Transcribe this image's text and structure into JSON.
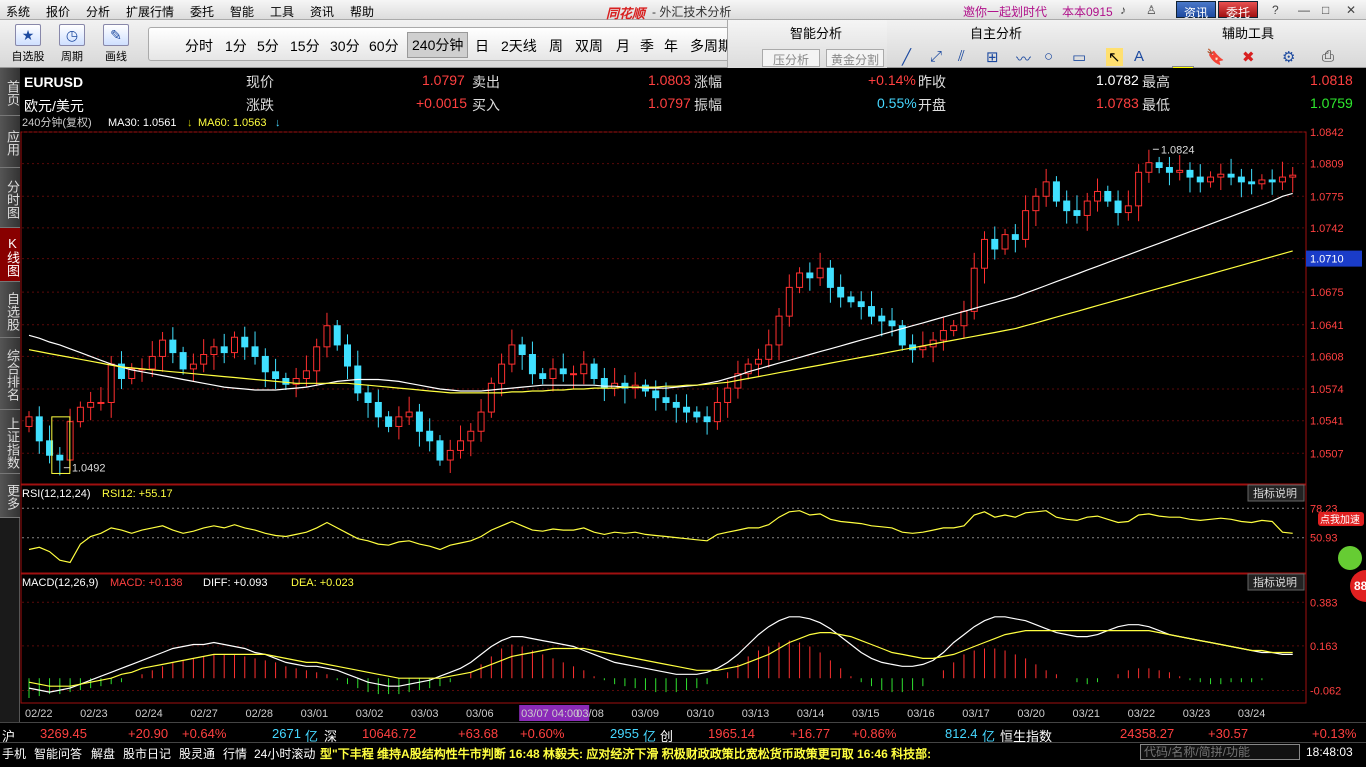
{
  "menu": [
    "系统",
    "报价",
    "分析",
    "扩展行情",
    "委托",
    "智能",
    "工具",
    "资讯",
    "帮助"
  ],
  "brand": "同花顺",
  "app_title": "- 外汇技术分析",
  "promo": "邀你一起划时代",
  "version": "本本0915",
  "top_buttons": [
    "资讯",
    "委托"
  ],
  "toolbar": {
    "tools": [
      {
        "label": "自选股",
        "icon": "star-icon"
      },
      {
        "label": "周期",
        "icon": "clock-icon"
      },
      {
        "label": "画线",
        "icon": "pen-icon"
      }
    ],
    "periods": [
      "分时",
      "1分",
      "5分",
      "15分",
      "30分",
      "60分",
      "240分钟",
      "日",
      "2天线",
      "周",
      "双周",
      "月",
      "季",
      "年",
      "多周期"
    ],
    "active_period": "240分钟",
    "smart_title": "智能分析",
    "smart_buttons": [
      "压分析",
      "黄金分割"
    ],
    "draw_title": "自主分析",
    "aux_title": "辅助工具"
  },
  "side_tabs": [
    "首页",
    "应用",
    "分时图",
    "K线图",
    "自选股",
    "综合排名",
    "上证指数",
    "更多"
  ],
  "active_side_tab": "K线图",
  "quote": {
    "symbol": "EURUSD",
    "name": "欧元/美元",
    "labels": [
      "现价",
      "涨跌",
      "卖出",
      "买入",
      "涨幅",
      "振幅",
      "昨收",
      "开盘",
      "最高",
      "最低"
    ],
    "now": "1.0797",
    "change": "+0.0015",
    "ask": "1.0803",
    "bid": "1.0797",
    "change_pct": "+0.14%",
    "amplitude": "0.55%",
    "prev_close": "1.0782",
    "open": "1.0783",
    "high": "1.0818",
    "low": "1.0759"
  },
  "main_legend": {
    "period": "240分钟(复权)",
    "ma30": "MA30: 1.0561",
    "ma60": "MA60: 1.0563"
  },
  "rsi_legend": {
    "name": "RSI(12,12,24)",
    "value": "RSI12: +55.17"
  },
  "macd_legend": {
    "name": "MACD(12,26,9)",
    "macd": "MACD: +0.138",
    "diff": "DIFF: +0.093",
    "dea": "DEA: +0.023"
  },
  "indicator_help": "指标说明",
  "promo_badge": "点我加速",
  "badge_number": "88",
  "chart_data": {
    "type": "candlestick",
    "y_ticks": [
      "1.0842",
      "1.0809",
      "1.0775",
      "1.0742",
      "1.0710",
      "1.0675",
      "1.0641",
      "1.0608",
      "1.0574",
      "1.0541",
      "1.0507"
    ],
    "current_price_label": "1.0710",
    "ylim": [
      1.0475,
      1.0842
    ],
    "annotations": [
      {
        "text": "1.0824",
        "value": 1.0824
      },
      {
        "text": "1.0492",
        "value": 1.0492
      }
    ],
    "dates": [
      "02/22",
      "02/23",
      "02/24",
      "02/27",
      "02/28",
      "03/01",
      "03/02",
      "03/03",
      "03/06",
      "03/07 04:00",
      "03/08",
      "03/09",
      "03/10",
      "03/13",
      "03/14",
      "03/15",
      "03/16",
      "03/17",
      "03/20",
      "03/21",
      "03/22",
      "03/23",
      "03/24"
    ],
    "highlight_date": "03/07 04:00",
    "close": [
      1.0545,
      1.052,
      1.0505,
      1.05,
      1.054,
      1.0555,
      1.056,
      1.056,
      1.06,
      1.0585,
      1.0595,
      1.0595,
      1.0608,
      1.0625,
      1.0612,
      1.0595,
      1.06,
      1.061,
      1.0618,
      1.0612,
      1.0628,
      1.0618,
      1.0608,
      1.0592,
      1.0585,
      1.0579,
      1.0585,
      1.0593,
      1.0618,
      1.064,
      1.062,
      1.0598,
      1.057,
      1.056,
      1.0545,
      1.0535,
      1.0545,
      1.055,
      1.053,
      1.052,
      1.05,
      1.051,
      1.052,
      1.053,
      1.055,
      1.058,
      1.06,
      1.062,
      1.061,
      1.059,
      1.0585,
      1.0595,
      1.059,
      1.059,
      1.06,
      1.0585,
      1.0575,
      1.058,
      1.0575,
      1.0578,
      1.0572,
      1.0565,
      1.056,
      1.0555,
      1.055,
      1.0545,
      1.054,
      1.056,
      1.0575,
      1.059,
      1.06,
      1.0605,
      1.062,
      1.065,
      1.068,
      1.0695,
      1.069,
      1.07,
      1.068,
      1.067,
      1.0665,
      1.066,
      1.065,
      1.0645,
      1.064,
      1.062,
      1.0615,
      1.0618,
      1.0625,
      1.0635,
      1.064,
      1.0655,
      1.07,
      1.073,
      1.072,
      1.0735,
      1.073,
      1.076,
      1.0775,
      1.079,
      1.077,
      1.076,
      1.0755,
      1.077,
      1.078,
      1.077,
      1.0758,
      1.0765,
      1.08,
      1.081,
      1.0805,
      1.08,
      1.0802,
      1.0795,
      1.079,
      1.0795,
      1.0798,
      1.0795,
      1.079,
      1.0788,
      1.0792,
      1.079,
      1.0795,
      1.0797
    ],
    "ma30": [
      1.063,
      1.0627,
      1.0623,
      1.062,
      1.0616,
      1.0612,
      1.0608,
      1.0604,
      1.06,
      1.0597,
      1.0594,
      1.0592,
      1.059,
      1.0588,
      1.0586,
      1.0584,
      1.0582,
      1.058,
      1.0578,
      1.0576,
      1.0575,
      1.0574,
      1.0573,
      1.0573,
      1.0573,
      1.0574,
      1.0575,
      1.0576,
      1.0578,
      1.058,
      1.0582,
      1.0583,
      1.0584,
      1.0584,
      1.0584,
      1.0583,
      1.0582,
      1.058,
      1.0578,
      1.0576,
      1.0574,
      1.0573,
      1.0572,
      1.0572,
      1.0572,
      1.0573,
      1.0574,
      1.0575,
      1.0576,
      1.0577,
      1.0578,
      1.0578,
      1.0578,
      1.0578,
      1.0578,
      1.0578,
      1.0577,
      1.0577,
      1.0576,
      1.0576,
      1.0575,
      1.0575,
      1.0575,
      1.0576,
      1.0577,
      1.0578,
      1.058,
      1.0582,
      1.0585,
      1.0588,
      1.0592,
      1.0595,
      1.0598,
      1.0601,
      1.0604,
      1.0607,
      1.061,
      1.0613,
      1.0616,
      1.0619,
      1.0622,
      1.0625,
      1.0628,
      1.0631,
      1.0634,
      1.0637,
      1.064,
      1.0643,
      1.0646,
      1.0649,
      1.0652,
      1.0655,
      1.0658,
      1.0661,
      1.0664,
      1.0667,
      1.067,
      1.0674,
      1.0678,
      1.0682,
      1.0686,
      1.069,
      1.0694,
      1.0698,
      1.0702,
      1.0706,
      1.071,
      1.0714,
      1.0718,
      1.0722,
      1.0726,
      1.073,
      1.0734,
      1.0738,
      1.0742,
      1.0746,
      1.075,
      1.0754,
      1.0758,
      1.0762,
      1.0766,
      1.077,
      1.0775,
      1.0778
    ],
    "ma60": [
      1.0615,
      1.0613,
      1.0611,
      1.0609,
      1.0607,
      1.0605,
      1.0603,
      1.0601,
      1.0599,
      1.0597,
      1.0596,
      1.0595,
      1.0594,
      1.0593,
      1.0592,
      1.0591,
      1.059,
      1.0589,
      1.0588,
      1.0587,
      1.0586,
      1.0585,
      1.0584,
      1.0583,
      1.0582,
      1.0581,
      1.058,
      1.058,
      1.058,
      1.058,
      1.058,
      1.058,
      1.0579,
      1.0578,
      1.0577,
      1.0576,
      1.0575,
      1.0574,
      1.0573,
      1.0572,
      1.0571,
      1.057,
      1.057,
      1.057,
      1.057,
      1.057,
      1.057,
      1.0571,
      1.0571,
      1.0572,
      1.0572,
      1.0573,
      1.0573,
      1.0574,
      1.0574,
      1.0575,
      1.0575,
      1.0575,
      1.0576,
      1.0576,
      1.0576,
      1.0576,
      1.0577,
      1.0577,
      1.0578,
      1.0578,
      1.0579,
      1.058,
      1.0581,
      1.0583,
      1.0585,
      1.0587,
      1.0589,
      1.0591,
      1.0593,
      1.0595,
      1.0597,
      1.0599,
      1.0601,
      1.0603,
      1.0605,
      1.0607,
      1.0609,
      1.0611,
      1.0613,
      1.0615,
      1.0617,
      1.0619,
      1.0621,
      1.0623,
      1.0625,
      1.0627,
      1.0629,
      1.0631,
      1.0633,
      1.0635,
      1.0637,
      1.064,
      1.0643,
      1.0646,
      1.0649,
      1.0652,
      1.0655,
      1.0658,
      1.0661,
      1.0664,
      1.0667,
      1.067,
      1.0673,
      1.0676,
      1.0679,
      1.0682,
      1.0685,
      1.0688,
      1.0691,
      1.0694,
      1.0697,
      1.07,
      1.0703,
      1.0706,
      1.0709,
      1.0712,
      1.0715,
      1.0718
    ],
    "rsi": {
      "ylim": [
        20,
        85
      ],
      "ticks": [
        "78.23",
        "50.93"
      ],
      "values": [
        40,
        42,
        38,
        30,
        28,
        45,
        52,
        55,
        60,
        58,
        55,
        58,
        60,
        62,
        58,
        55,
        57,
        60,
        62,
        60,
        63,
        60,
        58,
        55,
        53,
        52,
        54,
        56,
        60,
        65,
        60,
        55,
        50,
        48,
        45,
        44,
        47,
        48,
        45,
        43,
        40,
        44,
        46,
        48,
        52,
        58,
        62,
        66,
        62,
        58,
        57,
        59,
        58,
        58,
        60,
        56,
        54,
        56,
        55,
        56,
        54,
        53,
        52,
        51,
        50,
        49,
        48,
        54,
        56,
        58,
        60,
        60,
        63,
        70,
        75,
        76,
        72,
        73,
        68,
        66,
        65,
        64,
        62,
        61,
        60,
        56,
        55,
        56,
        58,
        60,
        60,
        62,
        72,
        75,
        70,
        72,
        70,
        74,
        75,
        76,
        70,
        68,
        67,
        70,
        71,
        68,
        65,
        66,
        72,
        73,
        71,
        70,
        70,
        68,
        67,
        68,
        69,
        68,
        66,
        65,
        67,
        66,
        56,
        55
      ]
    },
    "macd": {
      "ylim": [
        -0.13,
        0.44
      ],
      "ticks": [
        "0.383",
        "0.163",
        "-0.062"
      ],
      "bars": [
        -0.1,
        -0.09,
        -0.08,
        -0.08,
        -0.07,
        -0.06,
        -0.05,
        -0.04,
        -0.03,
        -0.02,
        0.0,
        0.02,
        0.04,
        0.06,
        0.08,
        0.09,
        0.1,
        0.11,
        0.12,
        0.12,
        0.12,
        0.11,
        0.1,
        0.09,
        0.08,
        0.06,
        0.05,
        0.04,
        0.03,
        0.02,
        -0.01,
        -0.03,
        -0.05,
        -0.07,
        -0.08,
        -0.08,
        -0.08,
        -0.07,
        -0.06,
        -0.05,
        -0.04,
        -0.02,
        0.0,
        0.03,
        0.07,
        0.11,
        0.15,
        0.17,
        0.16,
        0.14,
        0.12,
        0.1,
        0.08,
        0.06,
        0.04,
        0.01,
        -0.01,
        -0.03,
        -0.04,
        -0.05,
        -0.06,
        -0.07,
        -0.07,
        -0.07,
        -0.06,
        -0.05,
        -0.03,
        0.0,
        0.03,
        0.07,
        0.11,
        0.14,
        0.16,
        0.18,
        0.19,
        0.18,
        0.16,
        0.13,
        0.09,
        0.05,
        0.01,
        -0.02,
        -0.04,
        -0.06,
        -0.07,
        -0.07,
        -0.06,
        -0.04,
        0.0,
        0.04,
        0.08,
        0.12,
        0.14,
        0.15,
        0.15,
        0.14,
        0.12,
        0.1,
        0.07,
        0.04,
        0.02,
        0.0,
        -0.02,
        -0.03,
        -0.02,
        0.0,
        0.02,
        0.04,
        0.05,
        0.05,
        0.04,
        0.03,
        0.01,
        -0.01,
        -0.02,
        -0.03,
        -0.03,
        -0.02,
        -0.02,
        -0.02,
        -0.01,
        0.0
      ],
      "diff": [
        -0.05,
        -0.06,
        -0.07,
        -0.06,
        -0.05,
        -0.03,
        -0.01,
        0.01,
        0.03,
        0.05,
        0.07,
        0.09,
        0.11,
        0.13,
        0.15,
        0.16,
        0.17,
        0.17,
        0.18,
        0.17,
        0.16,
        0.15,
        0.13,
        0.12,
        0.1,
        0.08,
        0.07,
        0.06,
        0.06,
        0.05,
        0.04,
        0.02,
        0.0,
        -0.02,
        -0.03,
        -0.04,
        -0.04,
        -0.03,
        -0.02,
        -0.01,
        0.01,
        0.03,
        0.05,
        0.08,
        0.12,
        0.16,
        0.19,
        0.21,
        0.21,
        0.2,
        0.19,
        0.18,
        0.17,
        0.16,
        0.14,
        0.12,
        0.1,
        0.08,
        0.07,
        0.06,
        0.05,
        0.04,
        0.03,
        0.02,
        0.02,
        0.02,
        0.03,
        0.05,
        0.08,
        0.12,
        0.17,
        0.22,
        0.26,
        0.29,
        0.31,
        0.31,
        0.3,
        0.28,
        0.25,
        0.21,
        0.17,
        0.13,
        0.1,
        0.08,
        0.07,
        0.06,
        0.06,
        0.07,
        0.09,
        0.13,
        0.18,
        0.22,
        0.26,
        0.29,
        0.31,
        0.31,
        0.3,
        0.29,
        0.27,
        0.25,
        0.23,
        0.22,
        0.21,
        0.21,
        0.22,
        0.24,
        0.26,
        0.27,
        0.27,
        0.26,
        0.24,
        0.22,
        0.21,
        0.2,
        0.19,
        0.18,
        0.17,
        0.16,
        0.15,
        0.14,
        0.13,
        0.13,
        0.12,
        0.12
      ],
      "dea": [
        -0.02,
        -0.03,
        -0.04,
        -0.04,
        -0.04,
        -0.03,
        -0.02,
        -0.01,
        0.0,
        0.02,
        0.03,
        0.05,
        0.06,
        0.07,
        0.08,
        0.09,
        0.1,
        0.11,
        0.12,
        0.12,
        0.12,
        0.12,
        0.12,
        0.12,
        0.11,
        0.1,
        0.09,
        0.08,
        0.08,
        0.07,
        0.06,
        0.05,
        0.04,
        0.03,
        0.02,
        0.01,
        0.0,
        0.0,
        0.0,
        0.0,
        0.0,
        0.01,
        0.02,
        0.03,
        0.05,
        0.07,
        0.09,
        0.11,
        0.12,
        0.13,
        0.14,
        0.15,
        0.15,
        0.15,
        0.15,
        0.14,
        0.13,
        0.12,
        0.11,
        0.1,
        0.09,
        0.08,
        0.07,
        0.06,
        0.05,
        0.04,
        0.04,
        0.04,
        0.05,
        0.06,
        0.08,
        0.1,
        0.12,
        0.15,
        0.18,
        0.2,
        0.22,
        0.23,
        0.23,
        0.22,
        0.21,
        0.19,
        0.17,
        0.15,
        0.13,
        0.12,
        0.11,
        0.1,
        0.1,
        0.11,
        0.12,
        0.14,
        0.16,
        0.18,
        0.2,
        0.22,
        0.23,
        0.24,
        0.24,
        0.24,
        0.24,
        0.24,
        0.24,
        0.24,
        0.24,
        0.24,
        0.24,
        0.24,
        0.24,
        0.24,
        0.23,
        0.22,
        0.21,
        0.2,
        0.19,
        0.18,
        0.17,
        0.16,
        0.15,
        0.14,
        0.14,
        0.13,
        0.13,
        0.13
      ]
    }
  },
  "index_bar": {
    "sh_label": "沪",
    "sh_value": "3269.45",
    "sh_change": "+20.90",
    "sh_pct": "+0.64%",
    "sh_vol": "2671",
    "sh_unit": "亿",
    "sz_label": "深",
    "sz_value": "10646.72",
    "sz_change": "+63.68",
    "sz_pct": "+0.60%",
    "sz_vol": "2955",
    "sz_unit": "亿",
    "cy_label": "创",
    "cy_value": "1965.14",
    "cy_change": "+16.77",
    "cy_pct": "+0.86%",
    "cy_vol": "812.4",
    "cy_unit": "亿",
    "hs_label": "恒生指数",
    "hs_value": "24358.27",
    "hs_change": "+30.57",
    "hs_pct": "+0.13%"
  },
  "status_bar": {
    "items": [
      "手机",
      "智能问答",
      "解盘",
      "股市日记",
      "股灵通",
      "行情",
      "24小时滚动"
    ],
    "ticker": "型\"下丰程 维持A股结构性牛市判断    16:48 林毅夫: 应对经济下滑 积极财政政策比宽松货币政策更可取    16:46 科技部:",
    "search_placeholder": "代码/名称/简拼/功能",
    "clock": "18:48:03"
  }
}
